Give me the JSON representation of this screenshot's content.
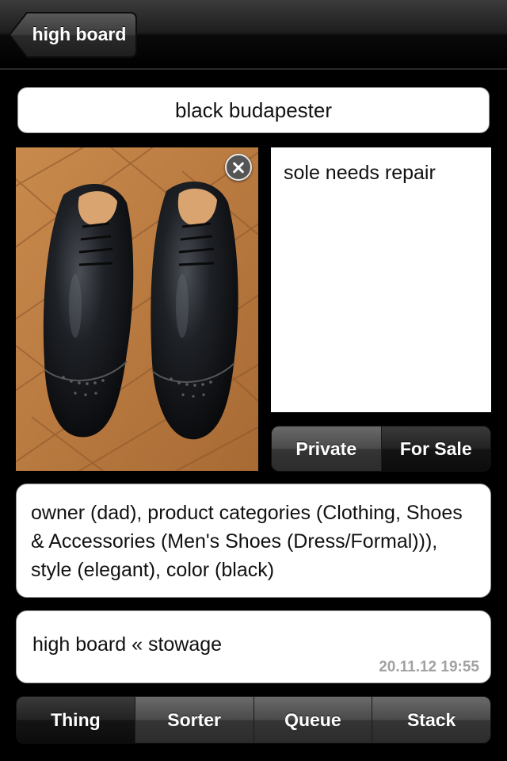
{
  "nav": {
    "back_label": "high board"
  },
  "item": {
    "title": "black budapester",
    "photo_subject": "pair of black brogue shoes on wooden parquet floor",
    "note": "sole needs repair",
    "tags": "owner (dad), product categories (Clothing, Shoes & Accessories (Men's Shoes (Dress/Formal))), style (elegant), color (black)",
    "location_path": "high board « stowage",
    "timestamp": "20.11.12 19:55"
  },
  "visibility": {
    "options": [
      "Private",
      "For Sale"
    ],
    "selected": "For Sale"
  },
  "tabs": {
    "items": [
      "Thing",
      "Sorter",
      "Queue",
      "Stack"
    ],
    "selected": "Thing"
  },
  "colors": {
    "background": "#000000",
    "field_background": "#ffffff",
    "timestamp_text": "#a2a2a2"
  },
  "icons": {
    "back": "back-arrow-icon",
    "remove_photo": "close-icon"
  }
}
